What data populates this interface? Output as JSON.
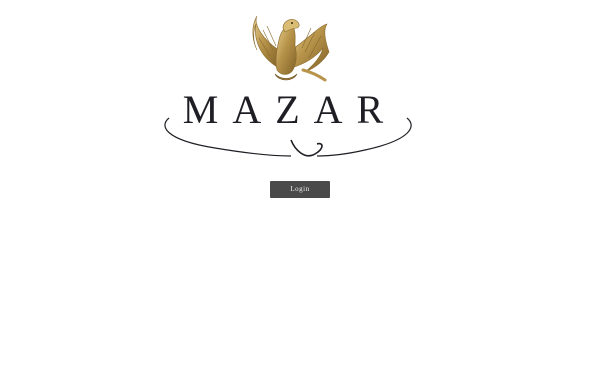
{
  "brand": {
    "name": "MAZAR",
    "logo_icon": "eagle-icon",
    "gold_color": "#b8944a",
    "text_color": "#1e1e24"
  },
  "login": {
    "label": "Login",
    "background_color": "#4a4a4a"
  }
}
